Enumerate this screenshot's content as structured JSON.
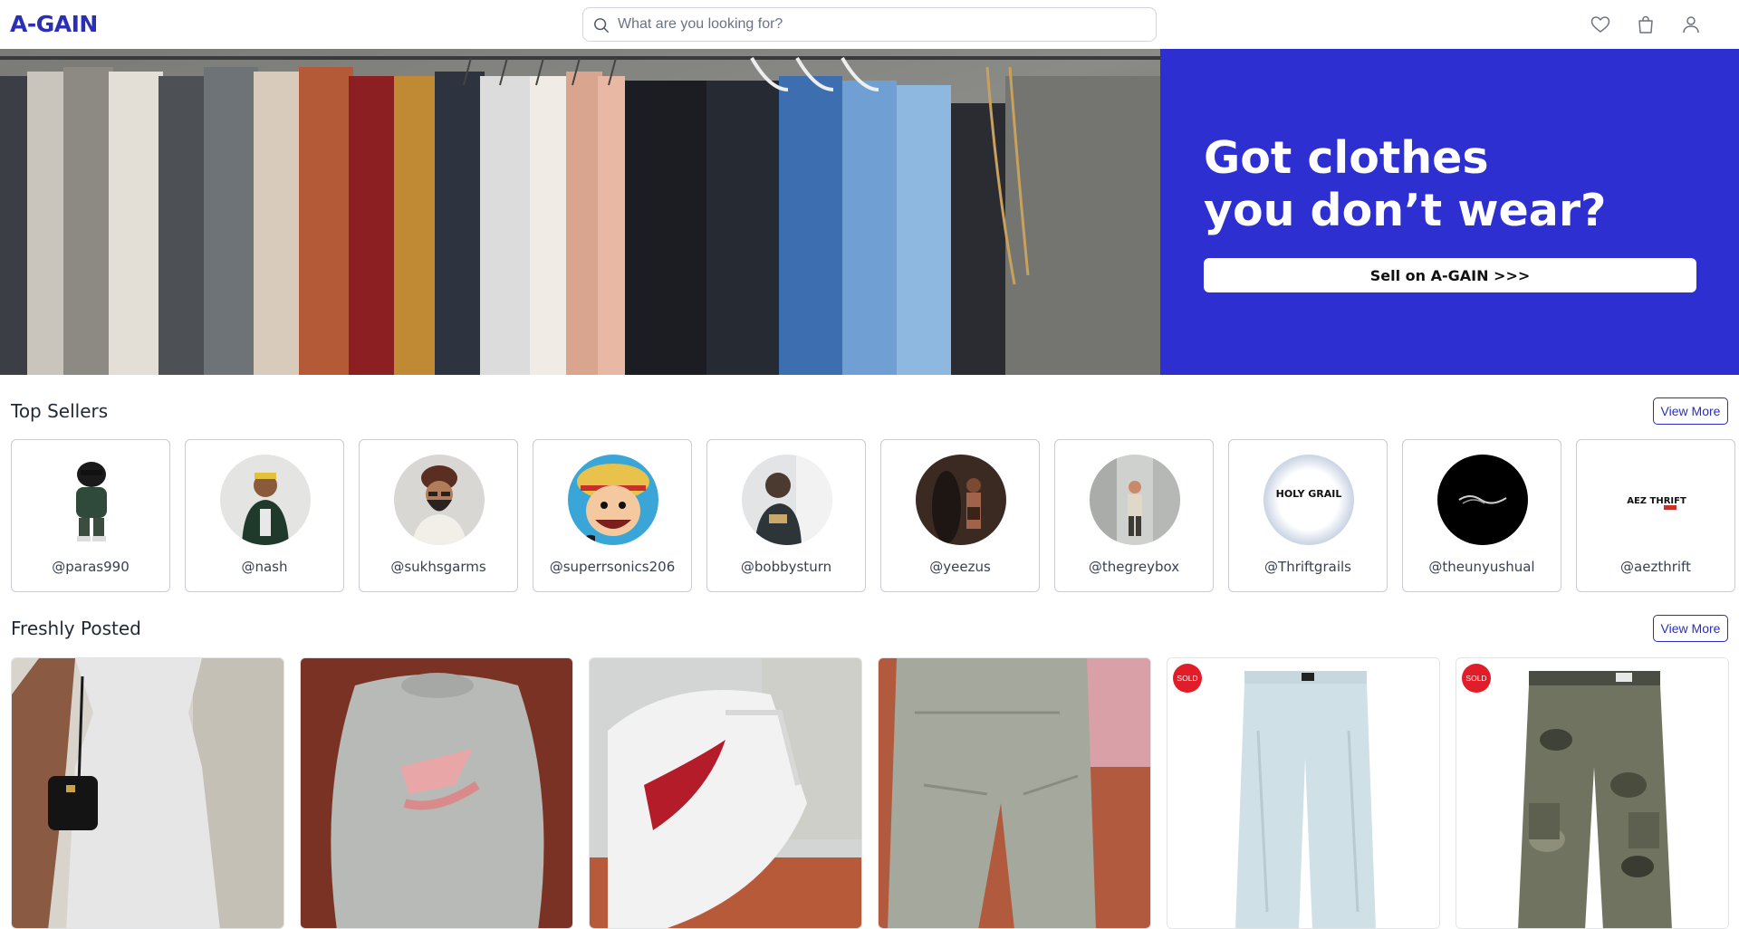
{
  "header": {
    "logo": "A-GAIN",
    "search_placeholder": "What are you looking for?",
    "icons": [
      "heart-icon",
      "bag-icon",
      "user-icon"
    ]
  },
  "hero": {
    "title_line1": "Got clothes",
    "title_line2": "you don’t wear?",
    "button_label": "Sell on A-GAIN >>>"
  },
  "top_sellers": {
    "title": "Top Sellers",
    "view_more": "View More",
    "sellers": [
      {
        "handle": "@paras990"
      },
      {
        "handle": "@nash"
      },
      {
        "handle": "@sukhsgarms"
      },
      {
        "handle": "@superrsonics206"
      },
      {
        "handle": "@bobbysturn"
      },
      {
        "handle": "@yeezus"
      },
      {
        "handle": "@thegreybox"
      },
      {
        "handle": "@Thriftgrails",
        "logo_text": "HOLY GRAIL"
      },
      {
        "handle": "@theunyushual"
      },
      {
        "handle": "@aezthrift",
        "logo_text": "AEZ THRIFT"
      }
    ]
  },
  "freshly_posted": {
    "title": "Freshly Posted",
    "view_more": "View More",
    "sold_label": "SOLD",
    "products": [
      {
        "item": "white dress",
        "sold": false
      },
      {
        "item": "grey nike sweatshirt",
        "sold": false
      },
      {
        "item": "white nike sneakers",
        "sold": false
      },
      {
        "item": "grey cargo pants",
        "sold": false
      },
      {
        "item": "light blue jeans",
        "sold": true
      },
      {
        "item": "camo pants",
        "sold": true
      }
    ]
  },
  "colors": {
    "brand": "#2a2fb5",
    "hero_panel": "#2e2fd0",
    "sold_badge": "#e11d2a"
  }
}
